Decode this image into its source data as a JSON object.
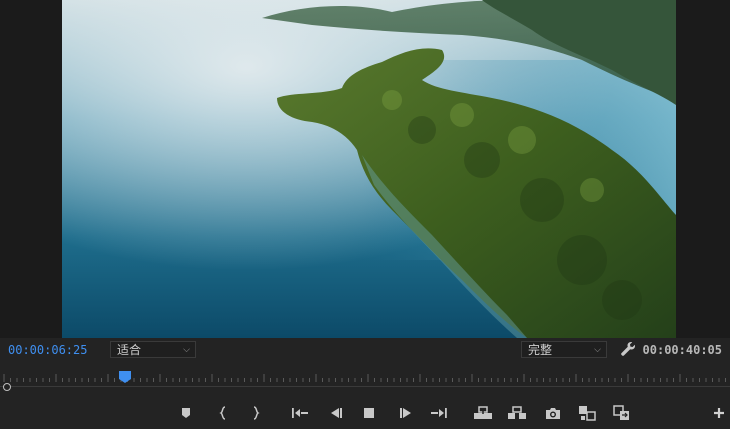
{
  "monitor": {
    "current_timecode": "00:00:06:25",
    "duration_timecode": "00:00:40:05",
    "zoom_select": {
      "selected": "适合"
    },
    "resolution_select": {
      "selected": "完整"
    }
  },
  "icons": {
    "marker": "add-marker-icon",
    "mark_in": "mark-in-icon",
    "mark_out": "mark-out-icon",
    "go_to_in": "go-to-in-icon",
    "step_back": "step-back-icon",
    "stop": "stop-icon",
    "step_forward": "step-forward-icon",
    "go_to_out": "go-to-out-icon",
    "lift": "lift-icon",
    "extract": "extract-icon",
    "export_frame": "camera-icon",
    "comparison_view": "comparison-view-icon",
    "proxy_toggle": "toggle-proxies-icon",
    "add_button": "plus-icon",
    "settings": "wrench-icon"
  },
  "colors": {
    "accent": "#3f8ff0",
    "panel_bg": "#232323",
    "text_muted": "#b8b8b8"
  }
}
